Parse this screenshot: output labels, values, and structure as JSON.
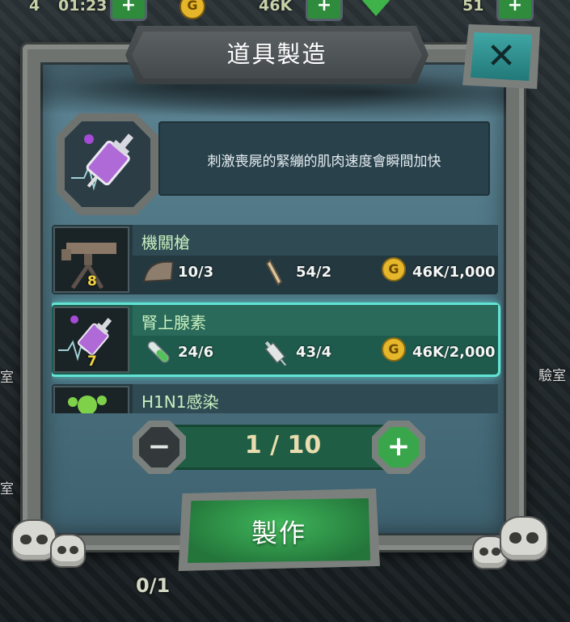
{
  "hud": {
    "left_number": "4",
    "timer": "01:23",
    "gold": "46K",
    "gems": "51",
    "plus": "+",
    "coin_letter": "G"
  },
  "background": {
    "left_labels": [
      "室",
      "室"
    ],
    "right_label": "驗室",
    "bottom_count": "0/1"
  },
  "dialog": {
    "title": "道具製造",
    "close_glyph": "✕",
    "description": "刺激喪屍的緊繃的肌肉速度會瞬間加快"
  },
  "recipes": [
    {
      "name": "機關槍",
      "level": "8",
      "selected": false,
      "costs": [
        {
          "icon": "leather-icon",
          "text": "10/3"
        },
        {
          "icon": "bullet-icon",
          "text": "54/2"
        },
        {
          "icon": "gold-coin-icon",
          "text": "46K/1,000"
        }
      ]
    },
    {
      "name": "腎上腺素",
      "level": "7",
      "selected": true,
      "costs": [
        {
          "icon": "test-tube-icon",
          "text": "24/6"
        },
        {
          "icon": "syringe-icon",
          "text": "43/4"
        },
        {
          "icon": "gold-coin-icon",
          "text": "46K/2,000"
        }
      ]
    },
    {
      "name": "H1N1感染",
      "level": "",
      "selected": false,
      "costs": []
    }
  ],
  "quantity": {
    "value": "1 / 10",
    "minus": "−",
    "plus": "+"
  },
  "craft_button": {
    "label": "製作"
  },
  "colors": {
    "accent_green": "#3aa64b",
    "selected_glow": "#62e3d3",
    "gold": "#e6b62b",
    "panel_teal": "#4f7684"
  }
}
